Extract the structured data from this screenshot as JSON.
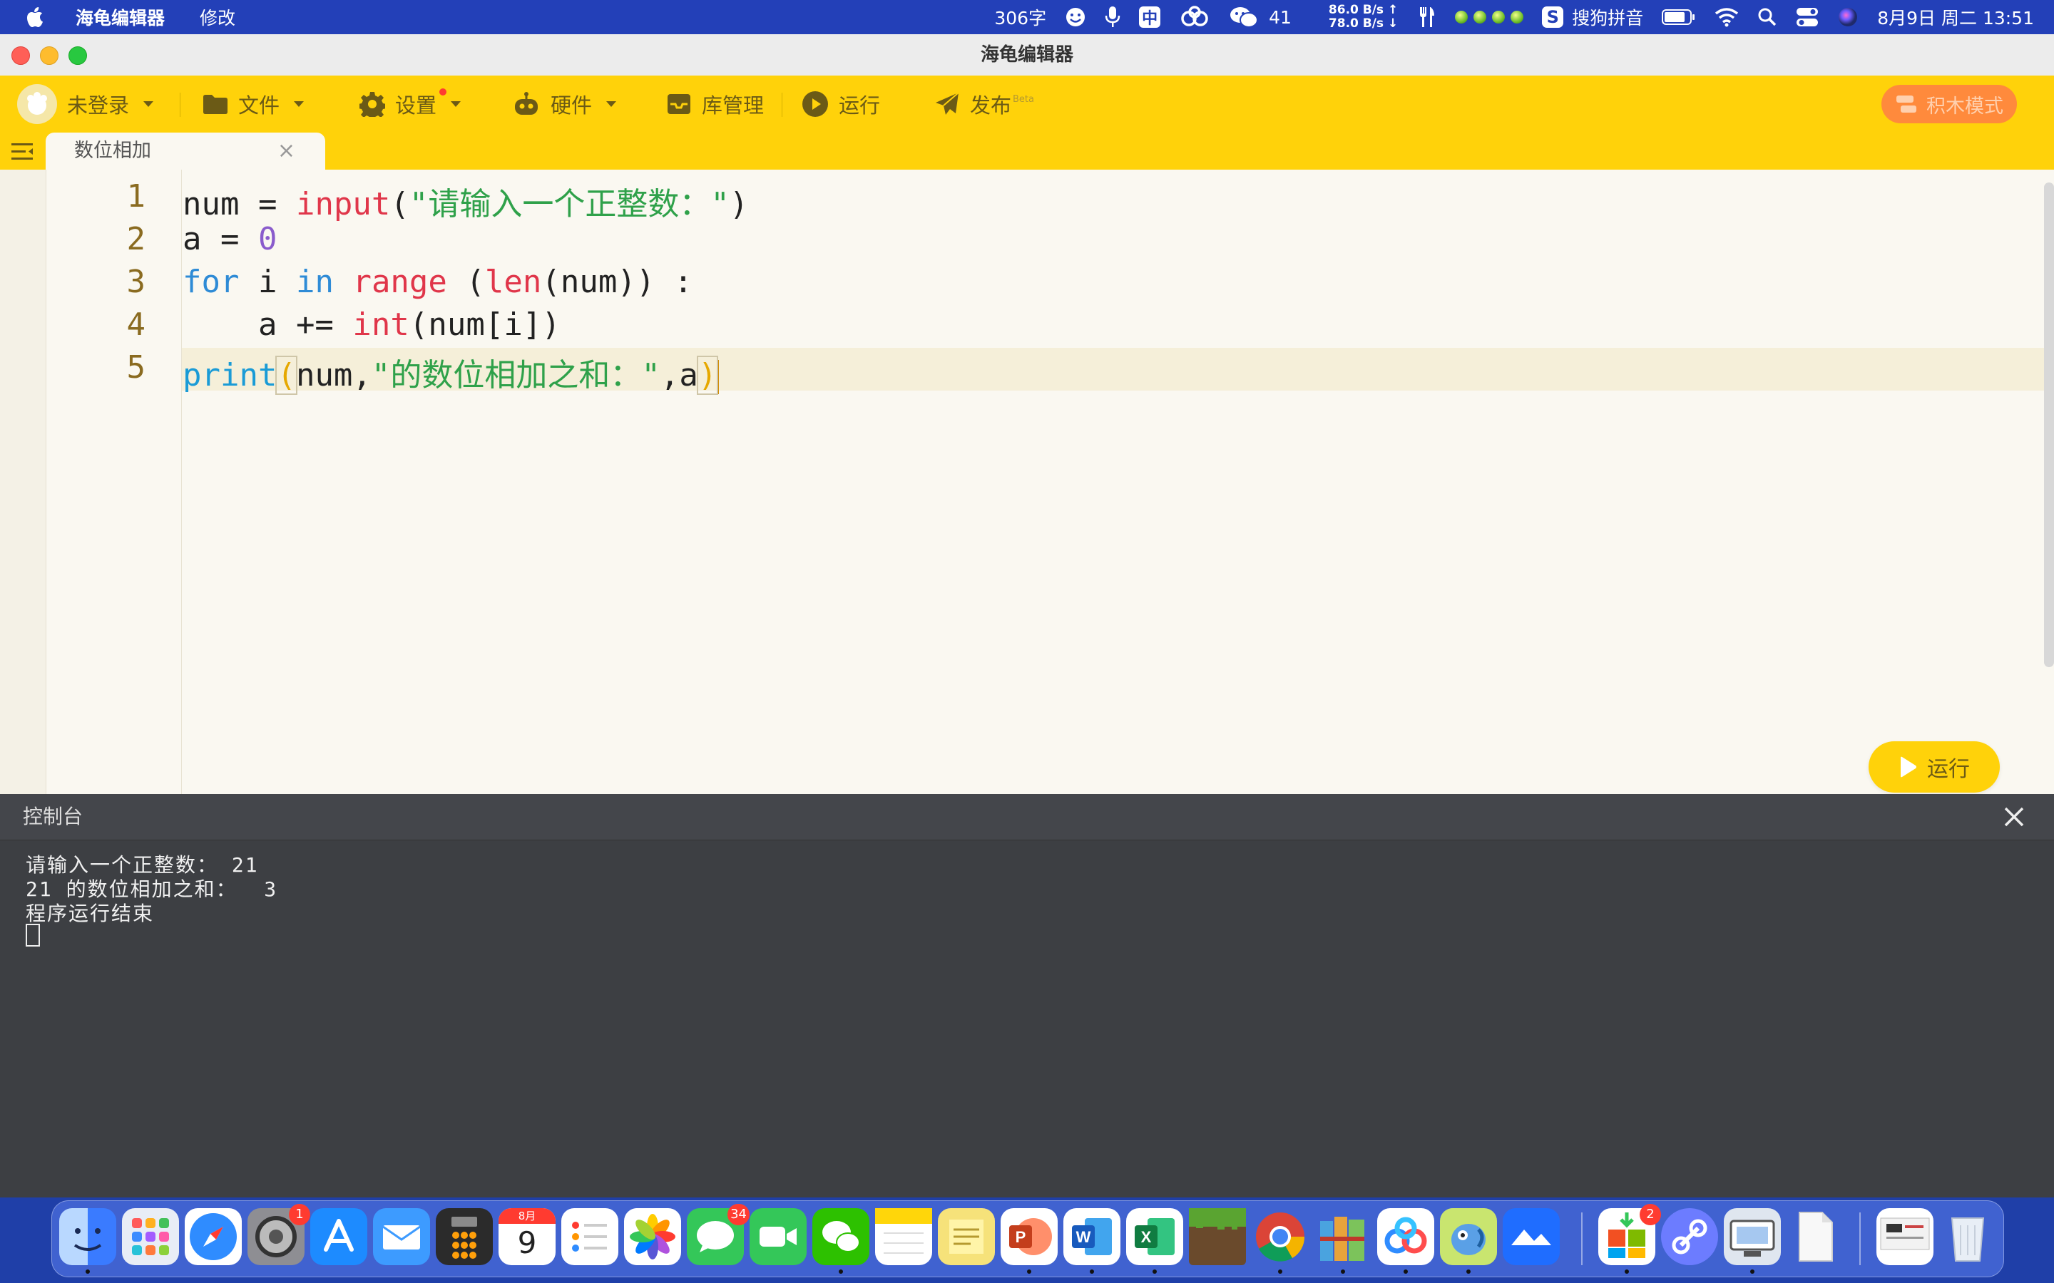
{
  "menubar": {
    "app_name": "海龟编辑器",
    "menu_edit": "修改",
    "word_count": "306字",
    "input_mode": "中",
    "wechat_count": "41",
    "net_up": "86.0 B/s ↑",
    "net_down": "78.0 B/s ↓",
    "ime_name": "搜狗拼音",
    "datetime": "8月9日 周二  13:51"
  },
  "window": {
    "title": "海龟编辑器"
  },
  "toolbar": {
    "login": "未登录",
    "file": "文件",
    "settings": "设置",
    "hardware": "硬件",
    "library": "库管理",
    "run": "运行",
    "publish": "发布",
    "publish_badge": "Beta",
    "block_mode": "积木模式"
  },
  "tab": {
    "label": "数位相加",
    "close": "×"
  },
  "editor": {
    "line_numbers": [
      "1",
      "2",
      "3",
      "4",
      "5"
    ],
    "code": {
      "l1": [
        "num = ",
        "input",
        "(",
        "\"请输入一个正整数：\"",
        ")"
      ],
      "l2": [
        "a = ",
        "0"
      ],
      "l3": [
        "for",
        " i ",
        "in",
        " ",
        "range",
        " (",
        "len",
        "(num)) :"
      ],
      "l4": [
        "    a += ",
        "int",
        "(num[i])"
      ],
      "l5": [
        "print",
        "(",
        "num,",
        "\"的数位相加之和：\"",
        ",a",
        ")"
      ]
    },
    "run_button": "运行"
  },
  "console": {
    "title": "控制台",
    "lines": [
      "请输入一个正整数： 21",
      "21 的数位相加之和：  3",
      "程序运行结束"
    ]
  },
  "dock": {
    "badges": {
      "settings": "1",
      "messages": "34",
      "store": "2"
    },
    "calendar_month": "8月",
    "calendar_day": "9"
  },
  "colors": {
    "toolbar_yellow": "#ffd20a",
    "keyword_blue": "#2e8bd6",
    "function_red": "#e0364a",
    "string_green": "#2fa14a",
    "number_purple": "#8a5ccc",
    "console_bg": "#3d3f43"
  }
}
